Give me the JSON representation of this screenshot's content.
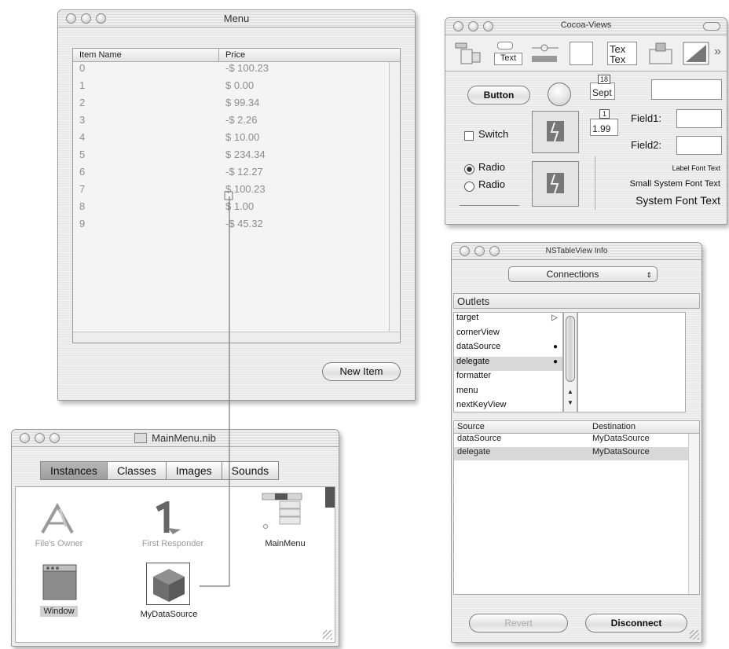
{
  "menu_window": {
    "title": "Menu",
    "columns": [
      "Item Name",
      "Price"
    ],
    "rows": [
      [
        "0",
        "-$ 100.23"
      ],
      [
        "1",
        "$ 0.00"
      ],
      [
        "2",
        "$ 99.34"
      ],
      [
        "3",
        "-$ 2.26"
      ],
      [
        "4",
        "$ 10.00"
      ],
      [
        "5",
        "$ 234.34"
      ],
      [
        "6",
        "-$ 12.27"
      ],
      [
        "7",
        "$ 100.23"
      ],
      [
        "8",
        "$ 1.00"
      ],
      [
        "9",
        "-$ 45.32"
      ]
    ],
    "new_item_label": "New Item"
  },
  "nib_window": {
    "title": "MainMenu.nib",
    "tabs": [
      "Instances",
      "Classes",
      "Images",
      "Sounds"
    ],
    "selected_tab": "Instances",
    "instances": {
      "files_owner": "File's Owner",
      "first_responder": "First Responder",
      "main_menu": "MainMenu",
      "window": "Window",
      "datasource": "MyDataSource"
    }
  },
  "cocoa_views": {
    "title": "Cocoa-Views",
    "toolbar": {
      "text_tool": "Text",
      "text_tool2": "Tex",
      "text_tool3": "Tex",
      "more": "»"
    },
    "button_label": "Button",
    "switch_label": "Switch",
    "radio1_label": "Radio",
    "radio2_label": "Radio",
    "date_text": "Sept",
    "date_badge": "18",
    "number_badge": "1",
    "number_text": "1.99",
    "field1_label": "Field1:",
    "field2_label": "Field2:",
    "label_font_text": "Label Font Text",
    "small_system_text": "Small System Font Text",
    "system_font_text": "System Font Text"
  },
  "info_window": {
    "title": "NSTableView Info",
    "popup_value": "Connections",
    "outlets_header": "Outlets",
    "outlets": [
      {
        "name": "target",
        "mark": "▷"
      },
      {
        "name": "cornerView",
        "mark": ""
      },
      {
        "name": "dataSource",
        "mark": "●"
      },
      {
        "name": "delegate",
        "mark": "●"
      },
      {
        "name": "formatter",
        "mark": ""
      },
      {
        "name": "menu",
        "mark": ""
      },
      {
        "name": "nextKeyView",
        "mark": ""
      }
    ],
    "selected_outlet": "delegate",
    "connection_columns": [
      "Source",
      "Destination"
    ],
    "connections": [
      [
        "dataSource",
        "MyDataSource"
      ],
      [
        "delegate",
        "MyDataSource"
      ]
    ],
    "revert_label": "Revert",
    "disconnect_label": "Disconnect"
  },
  "icons": [
    "window-close-light",
    "window-minimize-light",
    "window-zoom-light",
    "nib-file-icon",
    "files-owner-app-icon",
    "first-responder-icon",
    "main-menu-icon",
    "window-icon",
    "datasource-cube-icon"
  ]
}
